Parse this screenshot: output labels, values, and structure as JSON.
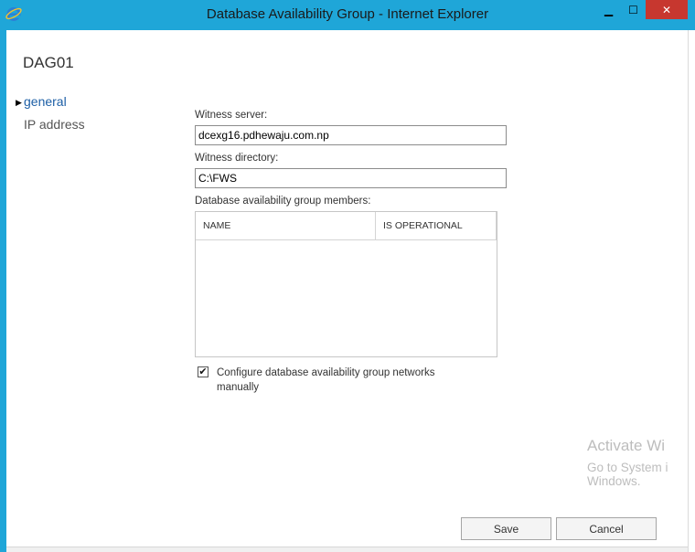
{
  "window": {
    "title": "Database Availability Group - Internet Explorer",
    "minimize_glyph": "▁",
    "maximize_glyph": "☐",
    "close_glyph": "✕",
    "accent_color": "#1fa6d8",
    "close_color": "#c7372f",
    "icon": "internet-explorer-icon"
  },
  "page": {
    "title": "DAG01"
  },
  "nav": {
    "items": [
      {
        "label": "general",
        "selected": true
      },
      {
        "label": "IP address",
        "selected": false
      }
    ],
    "selected_arrow": "▶"
  },
  "form": {
    "witness_server_label": "Witness server:",
    "witness_server_value": "dcexg16.pdhewaju.com.np",
    "witness_directory_label": "Witness directory:",
    "witness_directory_value": "C:\\FWS",
    "members_label": "Database availability group members:",
    "members_columns": [
      "NAME",
      "IS OPERATIONAL"
    ],
    "members_rows": [],
    "configure_networks_checked": true,
    "configure_networks_check_glyph": "✔",
    "configure_networks_label": "Configure database availability group networks manually"
  },
  "buttons": {
    "save": "Save",
    "cancel": "Cancel"
  },
  "watermark": {
    "line1": "Activate Wi",
    "line2": "Go to System i",
    "line3": "Windows."
  }
}
